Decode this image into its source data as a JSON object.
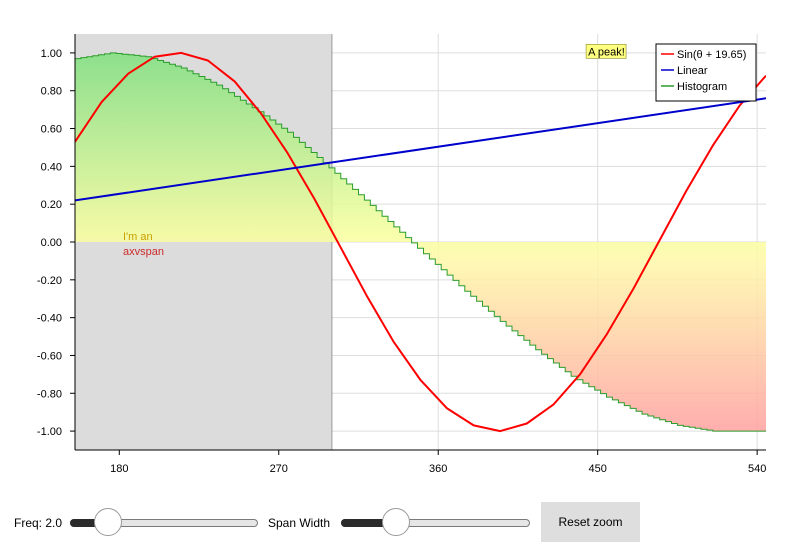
{
  "chart_data": {
    "type": "line",
    "xlim": [
      155,
      545
    ],
    "ylim": [
      -1.1,
      1.1
    ],
    "x_ticks": [
      180,
      270,
      360,
      450,
      540
    ],
    "x_tick_labels": [
      "180",
      "270",
      "360",
      "450",
      "540"
    ],
    "y_ticks": [
      1.0,
      0.8,
      0.6,
      0.4,
      0.2,
      0.0,
      -0.2,
      -0.4,
      -0.6,
      -0.8,
      -1.0
    ],
    "y_tick_labels": [
      "1.00",
      "0.80",
      "0.60",
      "0.40",
      "0.20",
      "0.00",
      "-0.20",
      "-0.40",
      "-0.60",
      "-0.80",
      "-1.00"
    ],
    "grid": true,
    "legend_position": "top-right",
    "series": [
      {
        "name": "Sin(θ + 19.65)",
        "color": "#ff0000",
        "x": [
          155,
          170,
          185,
          200,
          215,
          230,
          245,
          260,
          275,
          290,
          305,
          320,
          335,
          350,
          365,
          380,
          395,
          410,
          425,
          440,
          455,
          470,
          485,
          500,
          515,
          530,
          545
        ],
        "y": [
          0.53,
          0.74,
          0.89,
          0.98,
          1.0,
          0.96,
          0.85,
          0.68,
          0.47,
          0.23,
          -0.03,
          -0.29,
          -0.53,
          -0.73,
          -0.88,
          -0.97,
          -1.0,
          -0.96,
          -0.86,
          -0.7,
          -0.49,
          -0.25,
          0.01,
          0.27,
          0.51,
          0.72,
          0.88
        ]
      },
      {
        "name": "Linear",
        "color": "#0000cc",
        "x": [
          155,
          545
        ],
        "y": [
          0.22,
          0.76
        ]
      },
      {
        "name": "Histogram",
        "color": "#2a9d2a",
        "kind": "step-fill",
        "x": [
          155,
          175,
          195,
          215,
          235,
          255,
          275,
          295,
          315,
          335,
          355,
          375,
          395,
          415,
          435,
          455,
          475,
          495,
          515,
          535,
          545
        ],
        "y": [
          0.97,
          1.0,
          0.98,
          0.92,
          0.83,
          0.71,
          0.58,
          0.42,
          0.25,
          0.08,
          -0.09,
          -0.26,
          -0.42,
          -0.57,
          -0.71,
          -0.82,
          -0.91,
          -0.97,
          -1.0,
          -1.0,
          -1.0
        ]
      }
    ],
    "axvspan": {
      "x0": 155,
      "x1": 300,
      "label": "I'm an\naxvspan",
      "color": "#dcdcdc"
    },
    "annotations": [
      {
        "text": "A peak!",
        "x": 378,
        "y": 1.04
      }
    ]
  },
  "legend": {
    "items": [
      {
        "label": "Sin(θ + 19.65)",
        "color": "#ff0000"
      },
      {
        "label": "Linear",
        "color": "#0000cc"
      },
      {
        "label": "Histogram",
        "color": "#2a9d2a"
      }
    ]
  },
  "controls": {
    "freq_label": "Freq: 2.0",
    "freq_value": 0.2,
    "span_label": "Span Width",
    "span_value": 0.29,
    "reset_label": "Reset zoom"
  },
  "colors": {
    "axes_background": "#ffffff",
    "grid": "#dddddd",
    "fill_top": "#d7ff8c",
    "fill_bottom": "#ffa0a0"
  }
}
